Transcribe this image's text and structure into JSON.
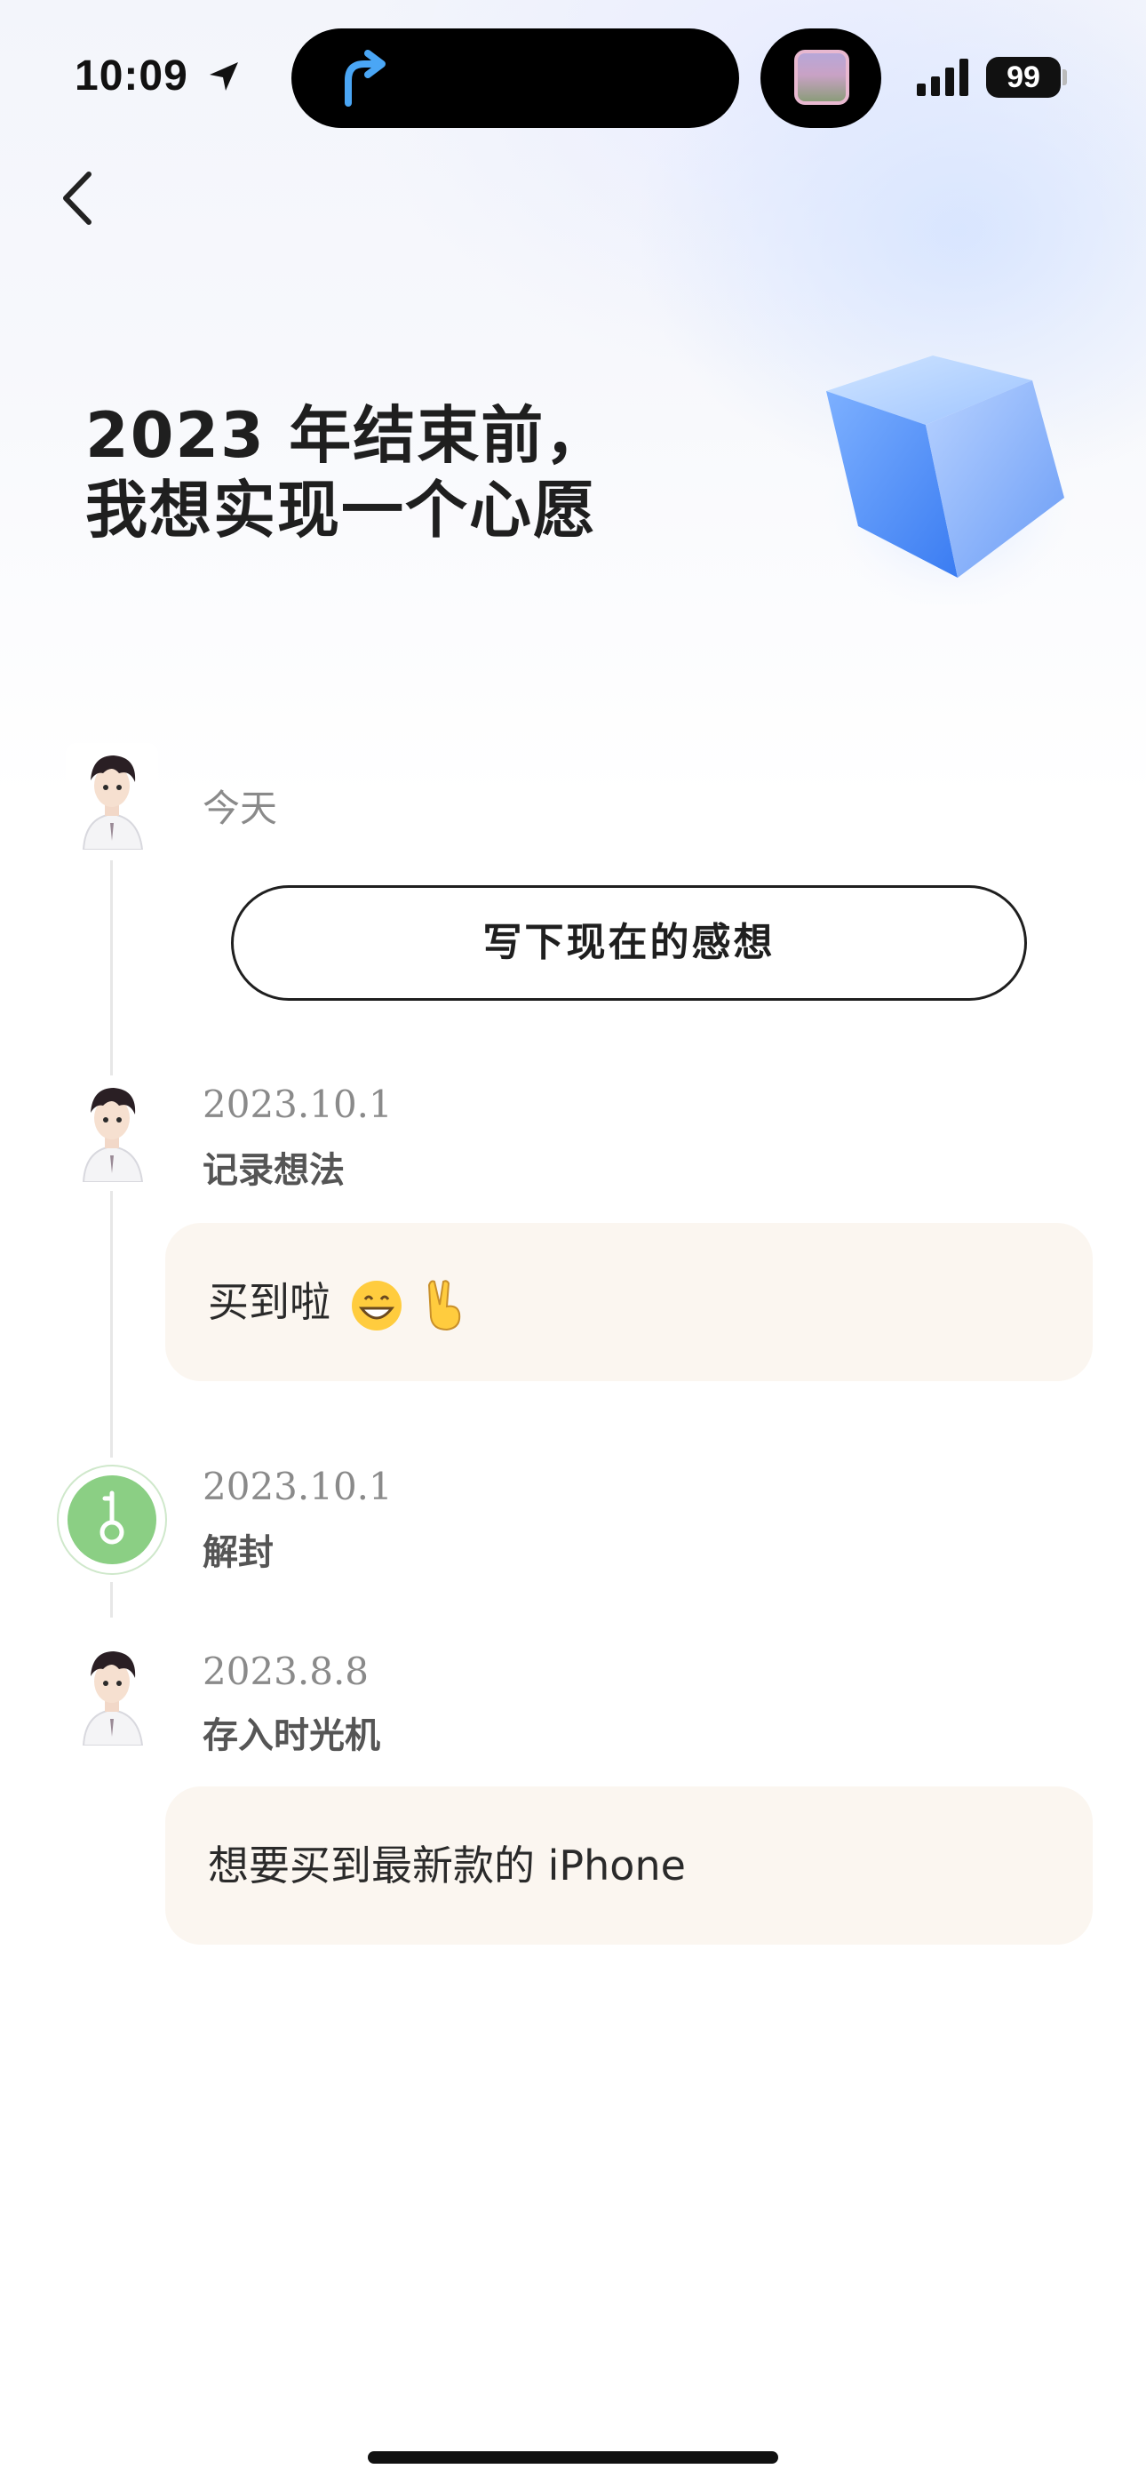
{
  "status_bar": {
    "time": "10:09",
    "battery": "99",
    "icons": [
      "location-arrow-icon",
      "navigation-arrow-icon",
      "camera-thumbnail",
      "signal-icon",
      "battery-icon"
    ]
  },
  "nav": {
    "back_icon": "chevron-left-icon"
  },
  "header": {
    "title_line1": "2023 年结束前，",
    "title_line2": "我想实现一个心愿",
    "decoration": "glass-cube-icon"
  },
  "timeline": {
    "today": {
      "label": "今天",
      "button_label": "写下现在的感想"
    },
    "entry1": {
      "date": "2023.10.1",
      "type": "记录想法",
      "content": "买到啦"
    },
    "entry2": {
      "date": "2023.10.1",
      "type": "解封",
      "icon": "key-icon"
    },
    "entry3": {
      "date": "2023.8.8",
      "type": "存入时光机",
      "content": "想要买到最新款的 iPhone"
    }
  },
  "colors": {
    "key_green": "#8bcf84",
    "card_bg": "#fbf6f0",
    "text_dark": "#1f1f1f",
    "date_gray": "#8a8a8a"
  }
}
